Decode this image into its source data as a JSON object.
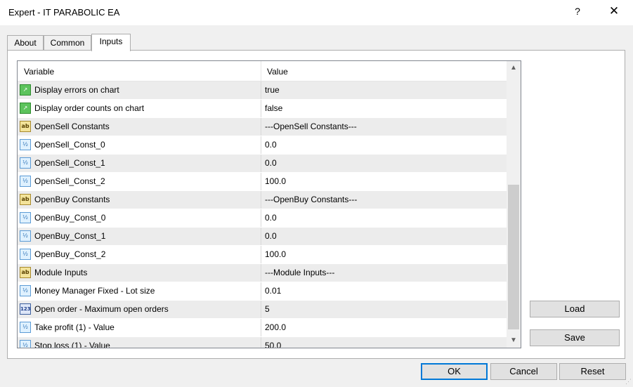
{
  "window": {
    "title": "Expert - IT PARABOLIC EA",
    "help_label": "?",
    "close_label": "✕"
  },
  "tabs": [
    {
      "label": "About",
      "active": false
    },
    {
      "label": "Common",
      "active": false
    },
    {
      "label": "Inputs",
      "active": true
    }
  ],
  "grid": {
    "headers": {
      "variable": "Variable",
      "value": "Value"
    },
    "rows": [
      {
        "icon": "bool",
        "icon_text": "↗",
        "name": "Display errors on chart",
        "value": "true"
      },
      {
        "icon": "bool",
        "icon_text": "↗",
        "name": "Display order counts on chart",
        "value": "false"
      },
      {
        "icon": "ab",
        "icon_text": "ab",
        "name": "OpenSell Constants",
        "value": "---OpenSell Constants---"
      },
      {
        "icon": "dbl",
        "icon_text": "½",
        "name": "OpenSell_Const_0",
        "value": "0.0"
      },
      {
        "icon": "dbl",
        "icon_text": "½",
        "name": "OpenSell_Const_1",
        "value": "0.0"
      },
      {
        "icon": "dbl",
        "icon_text": "½",
        "name": "OpenSell_Const_2",
        "value": "100.0"
      },
      {
        "icon": "ab",
        "icon_text": "ab",
        "name": "OpenBuy Constants",
        "value": "---OpenBuy Constants---"
      },
      {
        "icon": "dbl",
        "icon_text": "½",
        "name": "OpenBuy_Const_0",
        "value": "0.0"
      },
      {
        "icon": "dbl",
        "icon_text": "½",
        "name": "OpenBuy_Const_1",
        "value": "0.0"
      },
      {
        "icon": "dbl",
        "icon_text": "½",
        "name": "OpenBuy_Const_2",
        "value": "100.0"
      },
      {
        "icon": "ab",
        "icon_text": "ab",
        "name": "Module Inputs",
        "value": "---Module Inputs---"
      },
      {
        "icon": "dbl",
        "icon_text": "½",
        "name": "Money Manager Fixed - Lot size",
        "value": "0.01"
      },
      {
        "icon": "int",
        "icon_text": "123",
        "name": "Open order - Maximum open orders",
        "value": "5"
      },
      {
        "icon": "dbl",
        "icon_text": "½",
        "name": "Take profit (1) - Value",
        "value": "200.0"
      },
      {
        "icon": "dbl",
        "icon_text": "½",
        "name": "Stop loss (1) - Value",
        "value": "50.0"
      }
    ]
  },
  "scrollbar": {
    "up": "▲",
    "down": "▼"
  },
  "buttons": {
    "load": "Load",
    "save": "Save",
    "ok": "OK",
    "cancel": "Cancel",
    "reset": "Reset"
  }
}
